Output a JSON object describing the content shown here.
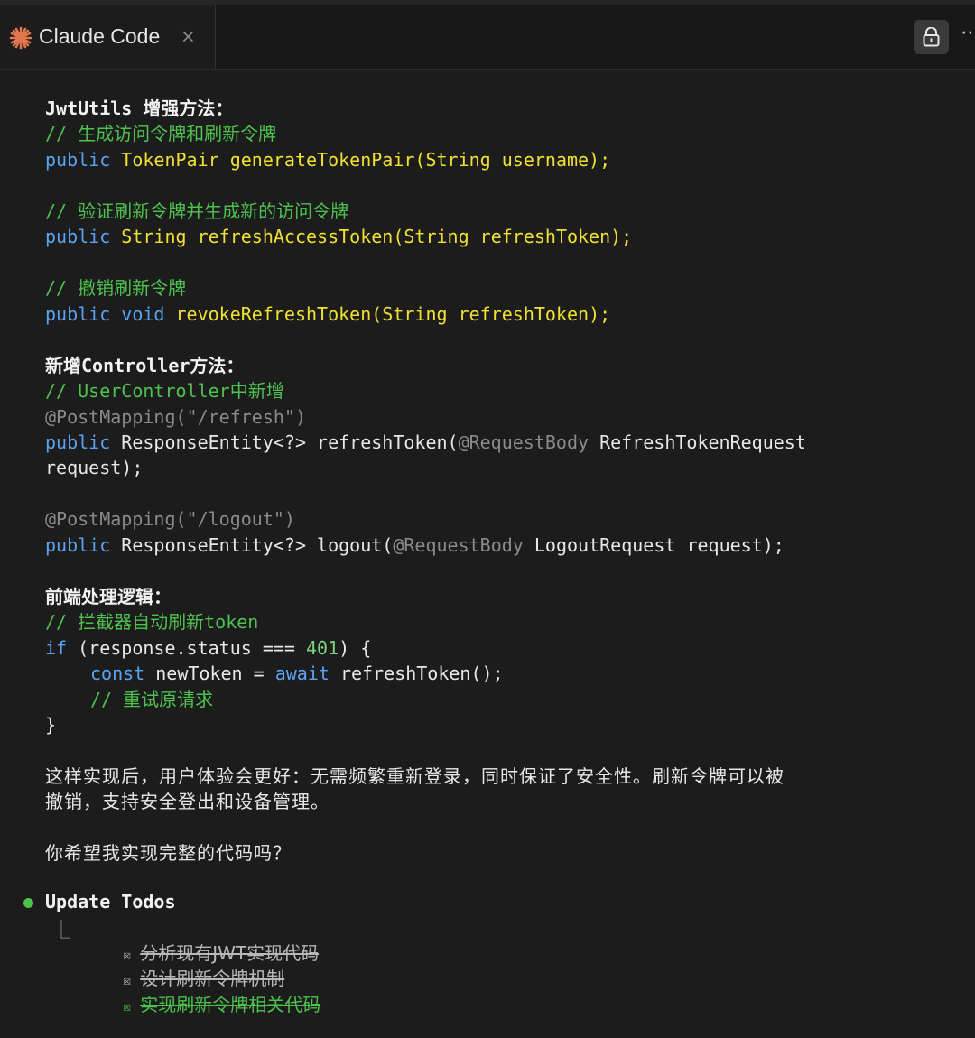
{
  "tab": {
    "title": "Claude Code",
    "close_glyph": "×"
  },
  "toolbar": {
    "lock_icon": "lock-icon",
    "more_glyph": "⋯"
  },
  "message": {
    "jwt_heading": "JwtUtils 增强方法：",
    "jwt_c1": "// 生成访问令牌和刷新令牌",
    "jwt_l1": [
      "public",
      " ",
      "TokenPair generateTokenPair(String username);"
    ],
    "jwt_c2": "// 验证刷新令牌并生成新的访问令牌",
    "jwt_l2": [
      "public",
      " ",
      "String refreshAccessToken(String refreshToken);"
    ],
    "jwt_c3": "// 撤销刷新令牌",
    "jwt_l3": [
      "public",
      " ",
      "void",
      " ",
      "revokeRefreshToken(String refreshToken);"
    ],
    "ctrl_heading": "新增Controller方法：",
    "ctrl_c1": "// UserController中新增",
    "ctrl_a1": "@PostMapping(\"/refresh\")",
    "ctrl_l1": [
      "public",
      " ResponseEntity<?> refreshToken(",
      "@RequestBody",
      " RefreshTokenRequest"
    ],
    "ctrl_l1b": "request);",
    "ctrl_a2": "@PostMapping(\"/logout\")",
    "ctrl_l2": [
      "public",
      " ResponseEntity<?> logout(",
      "@RequestBody",
      " LogoutRequest request);"
    ],
    "fe_heading": "前端处理逻辑：",
    "fe_c1": "// 拦截器自动刷新token",
    "fe_l1": [
      "if",
      " (response.status === ",
      "401",
      ") {"
    ],
    "fe_l2": [
      "const",
      " newToken = ",
      "await",
      " refreshToken();"
    ],
    "fe_c2": "// 重试原请求",
    "fe_l3": "}",
    "summary_1": "这样实现后，用户体验会更好：无需频繁重新登录，同时保证了安全性。刷新令牌可以被",
    "summary_2": "撤销，支持安全登出和设备管理。",
    "question": "你希望我实现完整的代码吗？"
  },
  "todos": {
    "title": "Update Todos",
    "branch_glyph": "⎿",
    "checkbox_glyph": "☒",
    "items": [
      {
        "label": "分析现有JWT实现代码",
        "status": "completed",
        "color": "#b8b8b8"
      },
      {
        "label": "设计刷新令牌机制",
        "status": "completed",
        "color": "#b8b8b8"
      },
      {
        "label": "实现刷新令牌相关代码",
        "status": "completed",
        "color": "#4cc24c"
      }
    ]
  },
  "colors": {
    "background": "#1c1c1c",
    "comment": "#4ec24e",
    "keyword": "#5aa3f2",
    "function": "#f0e130",
    "annotation": "#8a8a8a",
    "status_dot": "#4cc24c"
  }
}
